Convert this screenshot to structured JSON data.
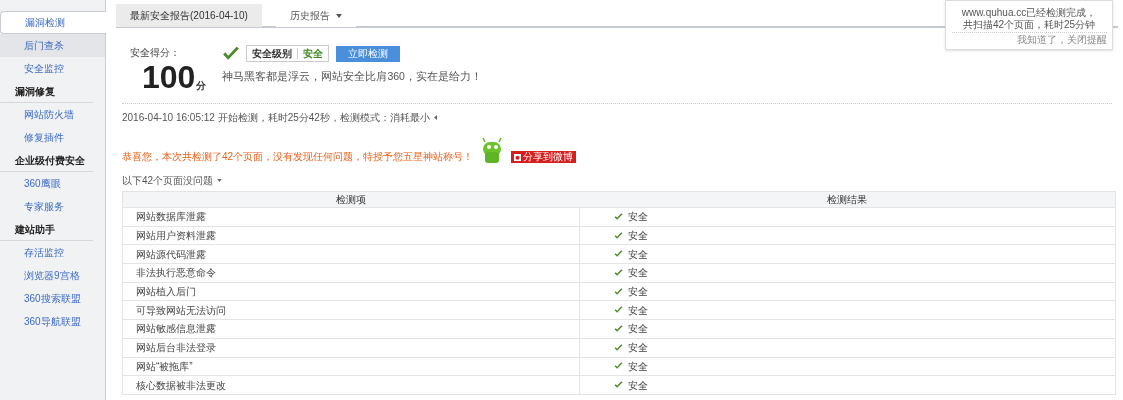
{
  "sidebar": {
    "items": [
      {
        "kind": "link",
        "label": "漏洞检测",
        "selected": true,
        "hovered": false
      },
      {
        "kind": "link",
        "label": "后门查杀",
        "selected": false,
        "hovered": true
      },
      {
        "kind": "link",
        "label": "安全监控",
        "selected": false,
        "hovered": false
      },
      {
        "kind": "header",
        "label": "漏洞修复"
      },
      {
        "kind": "link",
        "label": "网站防火墙",
        "selected": false,
        "hovered": false
      },
      {
        "kind": "link",
        "label": "修复插件",
        "selected": false,
        "hovered": false
      },
      {
        "kind": "header",
        "label": "企业级付费安全"
      },
      {
        "kind": "link",
        "label": "360鹰眼",
        "selected": false,
        "hovered": false
      },
      {
        "kind": "link",
        "label": "专家服务",
        "selected": false,
        "hovered": false
      },
      {
        "kind": "header",
        "label": "建站助手"
      },
      {
        "kind": "link",
        "label": "存活监控",
        "selected": false,
        "hovered": false
      },
      {
        "kind": "link",
        "label": "浏览器9宫格",
        "selected": false,
        "hovered": false
      },
      {
        "kind": "link",
        "label": "360搜索联盟",
        "selected": false,
        "hovered": false
      },
      {
        "kind": "link",
        "label": "360导航联盟",
        "selected": false,
        "hovered": false
      }
    ]
  },
  "tabs": [
    {
      "label": "最新安全报告(2016-04-10)",
      "selected": true,
      "dropdown": false
    },
    {
      "label": "历史报告",
      "selected": false,
      "dropdown": true
    }
  ],
  "notification": {
    "message_lines": [
      "www.quhua.cc已经检测完成，",
      "共扫描42个页面，耗时25分钟"
    ],
    "dismiss_link": "我知道了，关闭提醒"
  },
  "score": {
    "label": "安全得分：",
    "value": "100",
    "unit": "分",
    "level_label": "安全级别",
    "level_value": "安全",
    "scan_button": "立即检测",
    "slogan": "神马黑客都是浮云，网站安全比肩360，实在是给力！"
  },
  "scan_info": "2016-04-10 16:05:12 开始检测，耗时25分42秒，检测模式：消耗最小",
  "congrats": "恭喜您，本次共检测了42个页面，没有发现任何问题，特授予您五星神站称号！",
  "share_button": "分享到微博",
  "pages_toggle": "以下42个页面没问题",
  "table": {
    "columns": [
      "检测项",
      "检测结果"
    ],
    "rows": [
      {
        "item": "网站数据库泄露",
        "result": "安全",
        "safe": true
      },
      {
        "item": "网站用户资料泄露",
        "result": "安全",
        "safe": true
      },
      {
        "item": "网站源代码泄露",
        "result": "安全",
        "safe": true
      },
      {
        "item": "非法执行恶意命令",
        "result": "安全",
        "safe": true
      },
      {
        "item": "网站植入后门",
        "result": "安全",
        "safe": true
      },
      {
        "item": "可导致网站无法访问",
        "result": "安全",
        "safe": true
      },
      {
        "item": "网站敏感信息泄露",
        "result": "安全",
        "safe": true
      },
      {
        "item": "网站后台非法登录",
        "result": "安全",
        "safe": true
      },
      {
        "item": "网站“被拖库”",
        "result": "安全",
        "safe": true
      },
      {
        "item": "核心数据被非法更改",
        "result": "安全",
        "safe": true
      }
    ]
  }
}
